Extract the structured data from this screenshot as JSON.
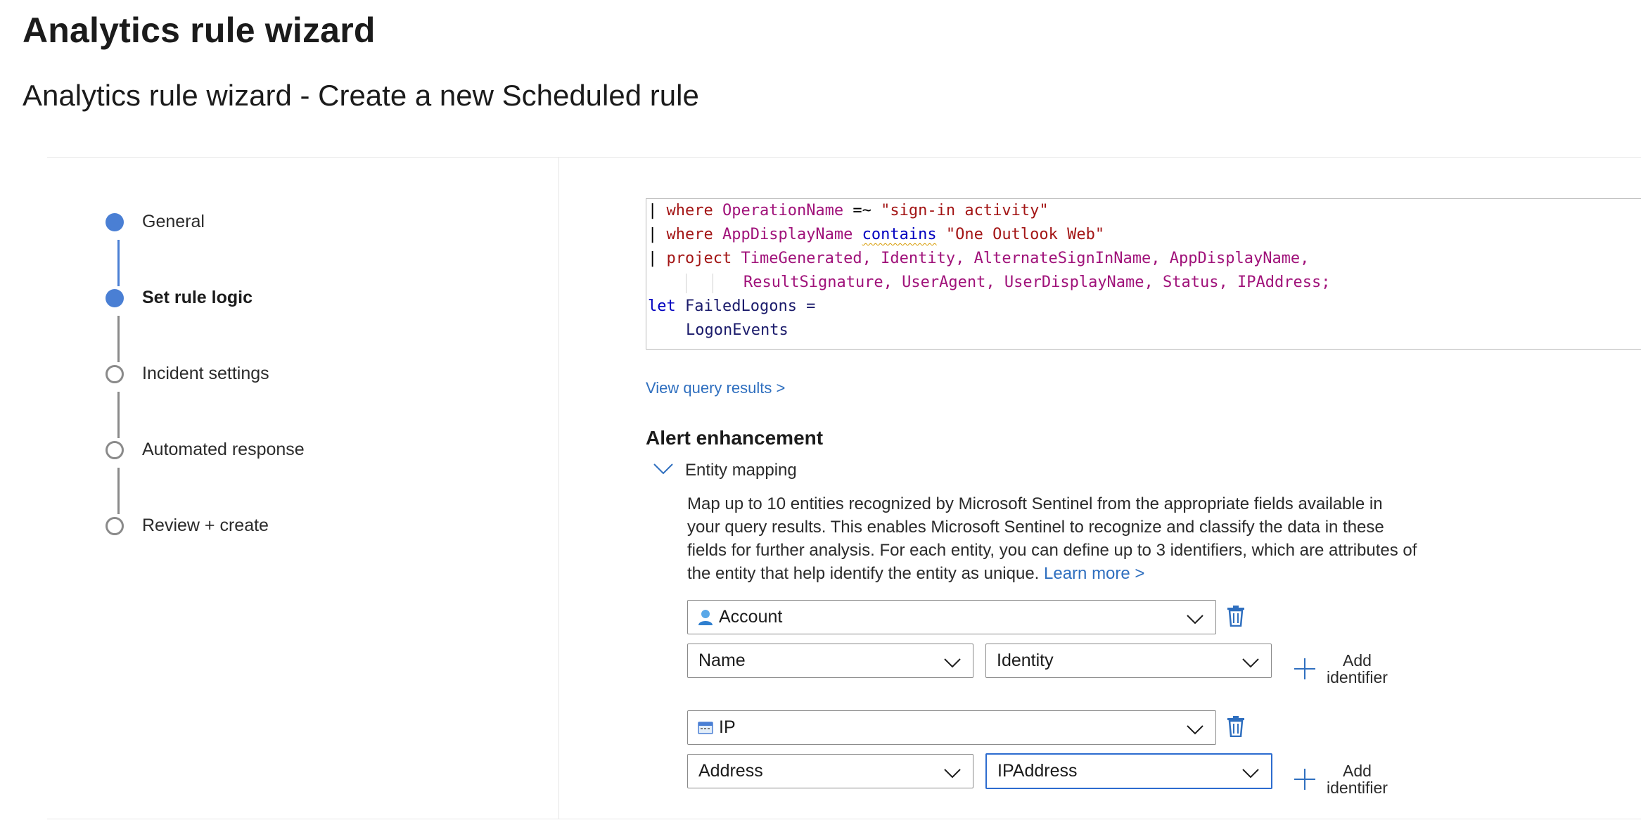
{
  "page": {
    "title": "Analytics rule wizard",
    "subtitle": "Analytics rule wizard - Create a new Scheduled rule"
  },
  "steps": [
    {
      "label": "General",
      "state": "completed"
    },
    {
      "label": "Set rule logic",
      "state": "current"
    },
    {
      "label": "Incident settings",
      "state": "pending"
    },
    {
      "label": "Automated response",
      "state": "pending"
    },
    {
      "label": "Review + create",
      "state": "pending"
    }
  ],
  "query": {
    "line1": {
      "pipe": "|",
      "kw": "where",
      "col": "OperationName",
      "op": "=~",
      "str": "\"sign-in activity\""
    },
    "line2": {
      "pipe": "|",
      "kw": "where",
      "col": "AppDisplayName",
      "op": "contains",
      "str": "\"One Outlook Web\""
    },
    "line3": {
      "pipe": "|",
      "kw": "project",
      "cols": "TimeGenerated, Identity, AlternateSignInName, AppDisplayName,"
    },
    "line4": {
      "cols": "ResultSignature, UserAgent, UserDisplayName, Status, IPAddress;"
    },
    "line5": {
      "kw": "let",
      "rest": "FailedLogons ="
    },
    "line6": {
      "rest": "LogonEvents"
    }
  },
  "view_results_link": "View query results >",
  "alert_enhancement": {
    "heading": "Alert enhancement",
    "entity_mapping_label": "Entity mapping",
    "description": "Map up to 10 entities recognized by Microsoft Sentinel from the appropriate fields available in your query results. This enables Microsoft Sentinel to recognize and classify the data in these fields for further analysis. For each entity, you can define up to 3 identifiers, which are attributes of the entity that help identify the entity as unique.",
    "learn_more": "Learn more >"
  },
  "entities": [
    {
      "type": "Account",
      "icon": "user-account-icon",
      "identifier": "Name",
      "column": "Identity",
      "add_label_1": "Add",
      "add_label_2": "identifier"
    },
    {
      "type": "IP",
      "icon": "ip-address-icon",
      "identifier": "Address",
      "column": "IPAddress",
      "add_label_1": "Add",
      "add_label_2": "identifier"
    }
  ],
  "colors": {
    "accent": "#4a7fd4",
    "link": "#2f6fbf",
    "focus": "#2d6ccf",
    "trash": "#2f6fbf"
  }
}
